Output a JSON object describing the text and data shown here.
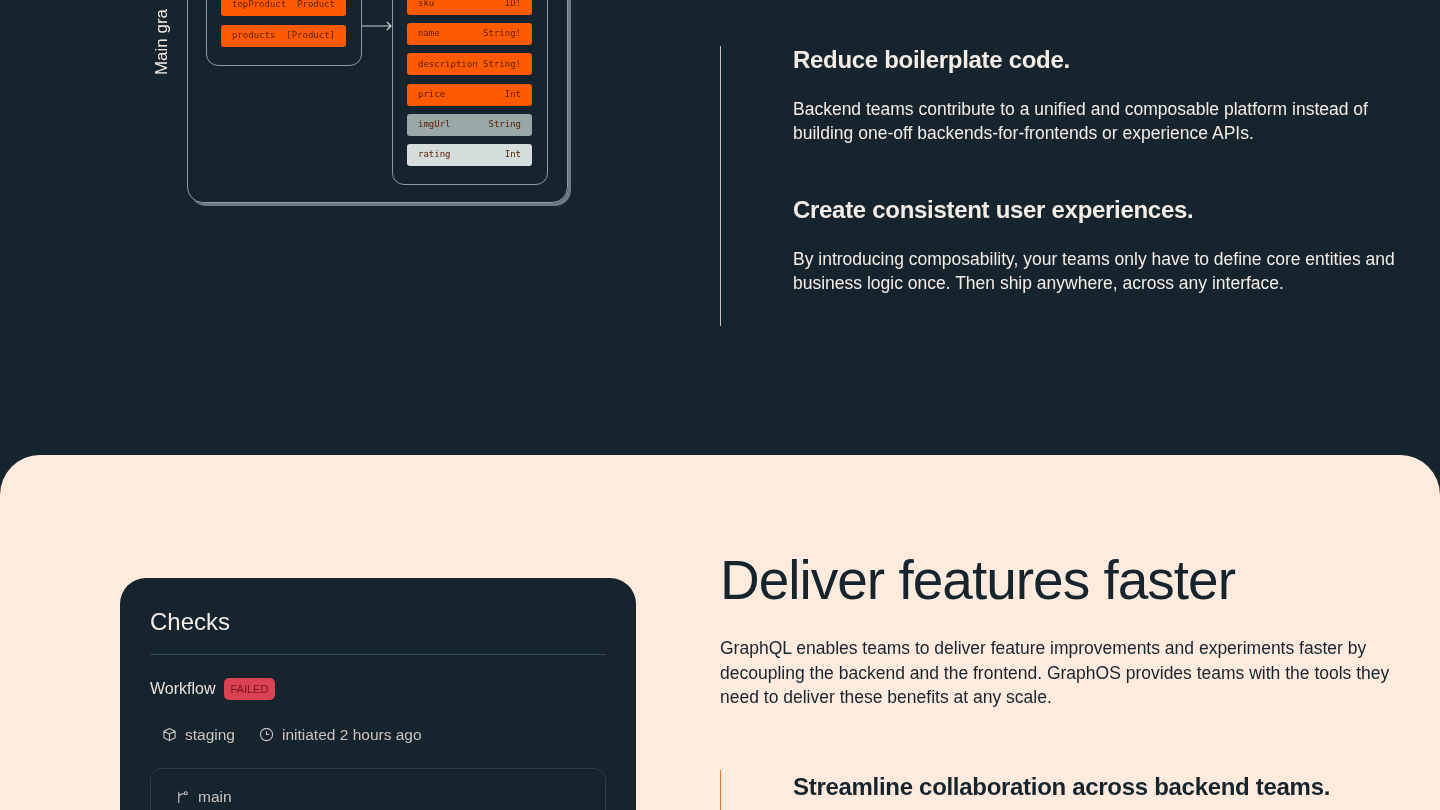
{
  "diagram": {
    "side_label": "Main gra",
    "left_fields": [
      {
        "name": "topProduct",
        "type": "Product",
        "color": "#ff5a00"
      },
      {
        "name": "products",
        "type": "[Product]",
        "color": "#ff5a00"
      }
    ],
    "right_fields": [
      {
        "name": "sku",
        "type": "ID!",
        "color": "#ff5a00"
      },
      {
        "name": "name",
        "type": "String!",
        "color": "#ff5a00"
      },
      {
        "name": "description",
        "type": "String!",
        "color": "#ff5a00"
      },
      {
        "name": "price",
        "type": "Int",
        "color": "#ff5a00"
      },
      {
        "name": "imgUrl",
        "type": "String",
        "color": "#9aa7a7"
      },
      {
        "name": "rating",
        "type": "Int",
        "color": "#d5dddd"
      }
    ]
  },
  "benefits": [
    {
      "title": "Reduce boilerplate code.",
      "text": "Backend teams contribute to a unified and composable platform instead of building one-off backends-for-frontends or experience APIs."
    },
    {
      "title": "Create consistent user experiences.",
      "text": "By introducing composability, your teams only have to define core entities and business logic once. Then ship anywhere, across any interface."
    }
  ],
  "deliver": {
    "heading": "Deliver features faster",
    "text": "GraphQL enables teams to deliver feature improvements and experiments faster by decoupling the backend and the frontend. GraphOS provides teams with the tools they need to deliver these benefits at any scale.",
    "checks_card": {
      "title": "Checks",
      "workflow_label": "Workflow",
      "status": {
        "label": "FAILED",
        "kind": "failed"
      },
      "environment": "staging",
      "initiated": "initiated 2 hours ago",
      "branch": "main"
    },
    "benefits": [
      {
        "title": "Streamline collaboration across backend teams."
      }
    ]
  }
}
